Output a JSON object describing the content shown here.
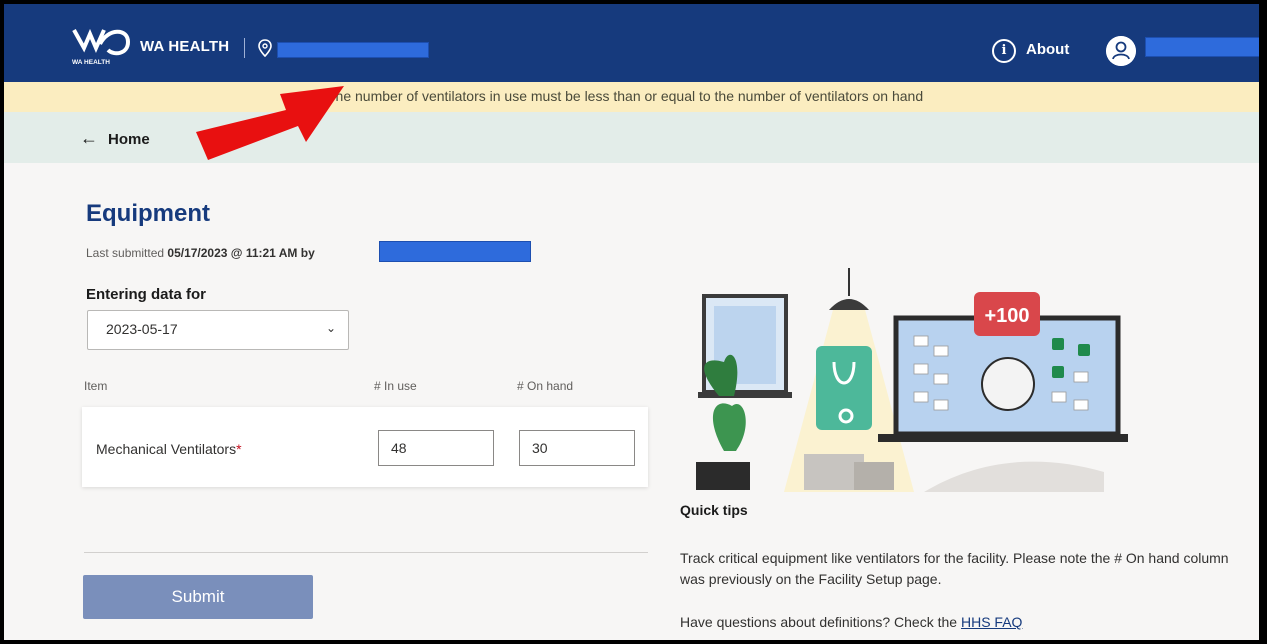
{
  "header": {
    "brand": "WA HEALTH",
    "logo_text": "WA HEALTH",
    "about_label": "About"
  },
  "alert": {
    "message": "The number of ventilators in use must be less than or equal to the number of ventilators on hand"
  },
  "nav": {
    "home_label": "Home"
  },
  "page": {
    "title": "Equipment",
    "last_submitted_prefix": "Last submitted",
    "last_submitted_value": "05/17/2023 @ 11:21 AM by"
  },
  "form": {
    "entering_label": "Entering data for",
    "date_value": "2023-05-17",
    "columns": {
      "item": "Item",
      "in_use": "# In use",
      "on_hand": "# On hand"
    },
    "rows": [
      {
        "label": "Mechanical Ventilators",
        "required_mark": "*",
        "in_use": "48",
        "on_hand": "30"
      }
    ],
    "submit_label": "Submit"
  },
  "tips": {
    "title": "Quick tips",
    "body": "Track critical equipment like ventilators for the facility. Please note the # On hand column was previously on the Facility Setup page.",
    "faq_prefix": "Have questions about definitions? Check the",
    "faq_link": "HHS FAQ",
    "badge": "+100"
  },
  "colors": {
    "header": "#163a7d",
    "alert_bg": "#fbedc0",
    "homebar_bg": "#e3ede9",
    "submit_bg": "#7a8fbb",
    "arrow": "#e81010",
    "redaction": "#2e6bdc"
  }
}
